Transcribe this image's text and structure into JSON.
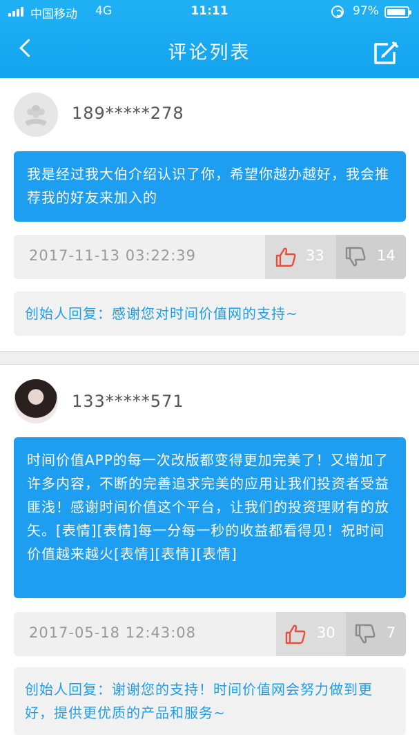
{
  "status_bar": {
    "carrier": "中国移动",
    "network": "4G",
    "time": "11:11",
    "battery": "97%"
  },
  "nav": {
    "title": "评论列表",
    "back_icon": "chevron-left-icon",
    "edit_icon": "compose-icon"
  },
  "colors": {
    "header": "#14a4ef",
    "bubble": "#1d9ef1",
    "reply_text": "#1e9ee8",
    "like_icon": "#e74c3c"
  },
  "comments": [
    {
      "username": "189*****278",
      "text": "我是经过我大伯介绍认识了你，希望你越办越好，我会推荐我的好友来加入的",
      "timestamp": "2017-11-13 03:22:39",
      "likes": "33",
      "dislikes": "14",
      "reply": "创始人回复：感谢您对时间价值网的支持~"
    },
    {
      "username": "133*****571",
      "text": "时间价值APP的每一次改版都变得更加完美了！又增加了许多内容，不断的完善追求完美的应用让我们投资者受益匪浅！感谢时间价值这个平台，让我们的投资理财有的放矢。[表情][表情]每一分每一秒的收益都看得见！祝时间价值越来越火[表情][表情][表情]",
      "timestamp": "2017-05-18 12:43:08",
      "likes": "30",
      "dislikes": "7",
      "reply": "创始人回复：谢谢您的支持！时间价值网会努力做到更好，提供更优质的产品和服务~"
    }
  ]
}
